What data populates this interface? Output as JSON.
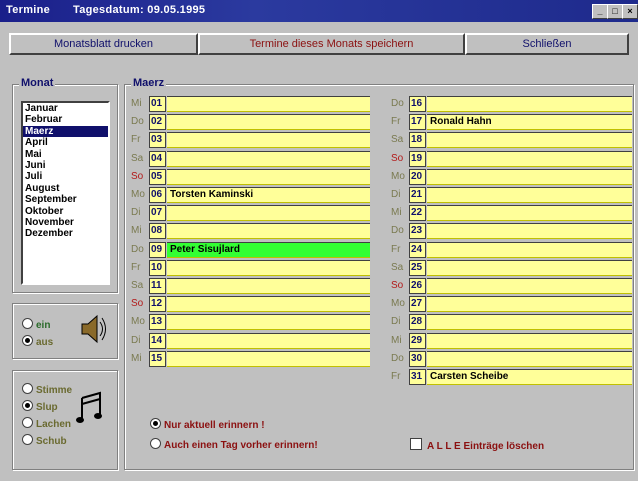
{
  "window": {
    "title": "Termine",
    "date_label": "Tagesdatum: 09.05.1995",
    "buttons": [
      "_",
      "□",
      "×"
    ]
  },
  "toolbar": {
    "print_label": "Monatsblatt drucken",
    "save_label": "Termine dieses Monats speichern",
    "close_label": "Schließen"
  },
  "month_panel": {
    "label": "Monat",
    "months": [
      "Januar",
      "Februar",
      "Maerz",
      "April",
      "Mai",
      "Juni",
      "Juli",
      "August",
      "September",
      "Oktober",
      "November",
      "Dezember"
    ],
    "selected": "Maerz"
  },
  "sound_panel": {
    "on_label": "ein",
    "off_label": "aus",
    "selected": "aus",
    "icon": "speaker-icon"
  },
  "music_panel": {
    "options": [
      "Stimme",
      "Slup",
      "Lachen",
      "Schub"
    ],
    "selected": "Slup",
    "icon": "music-notes-icon"
  },
  "calendar": {
    "label": "Maerz",
    "left_days": [
      {
        "dow": "Mi",
        "num": "01",
        "text": ""
      },
      {
        "dow": "Do",
        "num": "02",
        "text": ""
      },
      {
        "dow": "Fr",
        "num": "03",
        "text": ""
      },
      {
        "dow": "Sa",
        "num": "04",
        "text": ""
      },
      {
        "dow": "So",
        "num": "05",
        "text": ""
      },
      {
        "dow": "Mo",
        "num": "06",
        "text": "Torsten Kaminski"
      },
      {
        "dow": "Di",
        "num": "07",
        "text": ""
      },
      {
        "dow": "Mi",
        "num": "08",
        "text": ""
      },
      {
        "dow": "Do",
        "num": "09",
        "text": "Peter Sisujlard"
      },
      {
        "dow": "Fr",
        "num": "10",
        "text": ""
      },
      {
        "dow": "Sa",
        "num": "11",
        "text": ""
      },
      {
        "dow": "So",
        "num": "12",
        "text": ""
      },
      {
        "dow": "Mo",
        "num": "13",
        "text": ""
      },
      {
        "dow": "Di",
        "num": "14",
        "text": ""
      },
      {
        "dow": "Mi",
        "num": "15",
        "text": ""
      }
    ],
    "right_days": [
      {
        "dow": "Do",
        "num": "16",
        "text": ""
      },
      {
        "dow": "Fr",
        "num": "17",
        "text": "Ronald Hahn"
      },
      {
        "dow": "Sa",
        "num": "18",
        "text": ""
      },
      {
        "dow": "So",
        "num": "19",
        "text": ""
      },
      {
        "dow": "Mo",
        "num": "20",
        "text": ""
      },
      {
        "dow": "Di",
        "num": "21",
        "text": ""
      },
      {
        "dow": "Mi",
        "num": "22",
        "text": ""
      },
      {
        "dow": "Do",
        "num": "23",
        "text": ""
      },
      {
        "dow": "Fr",
        "num": "24",
        "text": ""
      },
      {
        "dow": "Sa",
        "num": "25",
        "text": ""
      },
      {
        "dow": "So",
        "num": "26",
        "text": ""
      },
      {
        "dow": "Mo",
        "num": "27",
        "text": ""
      },
      {
        "dow": "Di",
        "num": "28",
        "text": ""
      },
      {
        "dow": "Mi",
        "num": "29",
        "text": ""
      },
      {
        "dow": "Do",
        "num": "30",
        "text": ""
      },
      {
        "dow": "Fr",
        "num": "31",
        "text": "Carsten Scheibe"
      }
    ],
    "highlighted_num": "09",
    "highlight_color": "#33ff33",
    "field_color": "#ffff99"
  },
  "reminder": {
    "option_today": "Nur aktuell erinnern !",
    "option_before": "Auch einen Tag vorher erinnern!",
    "selected": "today",
    "clear_all_label": "A L L E  Einträge löschen",
    "clear_all_checked": false
  }
}
